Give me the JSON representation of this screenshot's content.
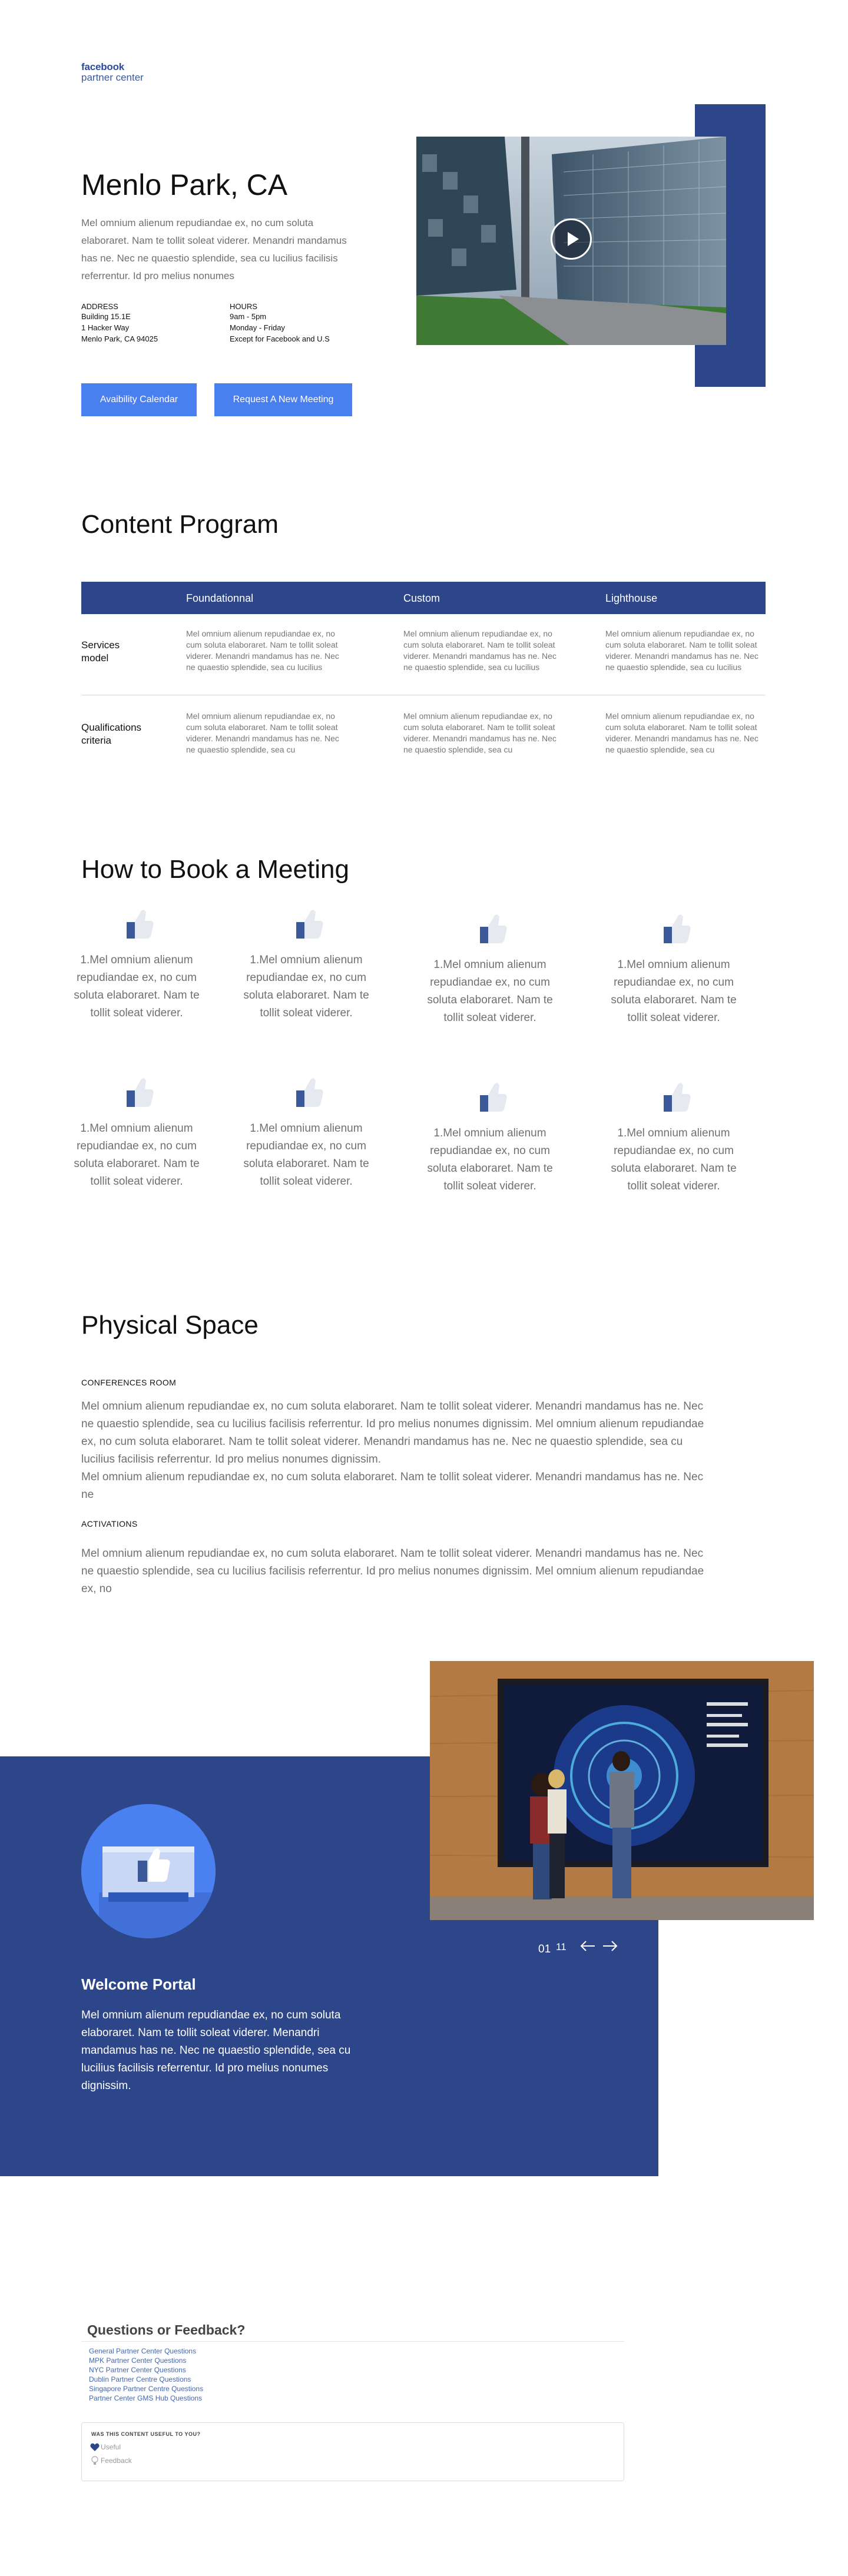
{
  "brand": {
    "line1": "facebook",
    "line2": "partner center"
  },
  "hero": {
    "title": "Menlo Park, CA",
    "description": "Mel omnium alienum repudiandae ex, no cum soluta elaboraret. Nam te tollit soleat viderer. Menandri mandamus has ne. Nec ne quaestio splendide, sea cu lucilius facilisis referrentur. Id pro melius nonumes",
    "address": {
      "label": "ADDRESS",
      "lines": [
        "Building 15.1E",
        "1 Hacker Way",
        "Menlo Park, CA 94025"
      ]
    },
    "hours": {
      "label": "HOURS",
      "lines": [
        "9am - 5pm",
        "Monday - Friday",
        "Except for Facebook and U.S"
      ]
    },
    "buttons": {
      "availability": "Avaibility Calendar",
      "request": "Request A New Meeting"
    },
    "video": {
      "play_icon": "play-icon"
    },
    "colors": {
      "accent": "#4a7ff0",
      "brand_dark": "#2d4689"
    }
  },
  "content_program": {
    "title": "Content Program",
    "columns": [
      "Foundationnal",
      "Custom",
      "Lighthouse"
    ],
    "rows": [
      {
        "label": "Services model",
        "cells": [
          "Mel omnium alienum repudiandae ex, no cum soluta elaboraret. Nam te tollit soleat viderer. Menandri mandamus has ne. Nec ne quaestio splendide, sea cu lucilius",
          "Mel omnium alienum repudiandae ex, no cum soluta elaboraret. Nam te tollit soleat viderer. Menandri mandamus has ne. Nec ne quaestio splendide, sea cu lucilius",
          "Mel omnium alienum repudiandae ex, no cum soluta elaboraret. Nam te tollit soleat viderer. Menandri mandamus has ne. Nec ne quaestio splendide, sea cu lucilius"
        ]
      },
      {
        "label": "Qualifications criteria",
        "cells": [
          "Mel omnium alienum repudiandae ex, no cum soluta elaboraret. Nam te tollit soleat viderer. Menandri mandamus has ne. Nec ne quaestio splendide, sea cu",
          "Mel omnium alienum repudiandae ex, no cum soluta elaboraret. Nam te tollit soleat viderer. Menandri mandamus has ne. Nec ne quaestio splendide, sea cu",
          "Mel omnium alienum repudiandae ex, no cum soluta elaboraret. Nam te tollit soleat viderer. Menandri mandamus has ne. Nec ne quaestio splendide, sea cu"
        ]
      }
    ]
  },
  "booking": {
    "title": "How to Book a Meeting",
    "icon": "thumbs-up-icon",
    "steps": [
      "1.Mel omnium alienum repudiandae ex, no cum soluta elaboraret. Nam te tollit soleat viderer.",
      "1.Mel omnium alienum repudiandae ex, no cum soluta elaboraret. Nam te tollit soleat viderer.",
      "1.Mel omnium alienum repudiandae ex, no cum soluta elaboraret. Nam te tollit soleat viderer.",
      "1.Mel omnium alienum repudiandae ex, no cum soluta elaboraret. Nam te tollit soleat viderer.",
      "1.Mel omnium alienum repudiandae ex, no cum soluta elaboraret. Nam te tollit soleat viderer.",
      "1.Mel omnium alienum repudiandae ex, no cum soluta elaboraret. Nam te tollit soleat viderer.",
      "1.Mel omnium alienum repudiandae ex, no cum soluta elaboraret. Nam te tollit soleat viderer.",
      "1.Mel omnium alienum repudiandae ex, no cum soluta elaboraret. Nam te tollit soleat viderer."
    ]
  },
  "physical_space": {
    "title": "Physical Space",
    "conference_label": "CONFERENCES ROOM",
    "conference_text": "Mel omnium alienum repudiandae ex, no cum soluta elaboraret. Nam te tollit soleat viderer. Menandri mandamus has ne. Nec ne quaestio splendide, sea cu lucilius facilisis referrentur. Id pro melius nonumes dignissim. Mel omnium alienum repudiandae ex, no cum soluta elaboraret. Nam te tollit soleat viderer. Menandri mandamus has ne. Nec ne quaestio splendide, sea cu lucilius facilisis referrentur. Id pro melius nonumes dignissim.",
    "conference_text_2": "Mel omnium alienum repudiandae ex, no cum soluta elaboraret. Nam te tollit soleat viderer. Menandri mandamus has ne. Nec ne",
    "activations_label": "ACTIVATIONS",
    "activations_text": "Mel omnium alienum repudiandae ex, no cum soluta elaboraret. Nam te tollit soleat viderer. Menandri mandamus has ne. Nec ne quaestio splendide, sea cu lucilius facilisis referrentur. Id pro melius nonumes dignissim. Mel omnium alienum repudiandae ex, no"
  },
  "portal": {
    "title": "Welcome Portal",
    "description": "Mel omnium alienum repudiandae ex, no cum soluta elaboraret. Nam te tollit soleat viderer. Menandri mandamus has ne. Nec ne quaestio splendide, sea cu lucilius facilisis referrentur. Id pro melius nonumes dignissim.",
    "pager_current": "01",
    "pager_total": "11",
    "prev_icon": "arrow-left-icon",
    "next_icon": "arrow-right-icon"
  },
  "feedback": {
    "title": "Questions or Feedback?",
    "links": [
      "General Partner Center Questions",
      "MPK Partner Center Questions",
      "NYC Partner Center Questions",
      "Dublin Partner Centre Questions",
      "Singapore Partner Centre Questions",
      "Partner Center GMS Hub Questions"
    ],
    "question": "WAS THIS CONTENT USEFUL TO YOU?",
    "useful": "Useful",
    "feedback": "Feedback"
  }
}
